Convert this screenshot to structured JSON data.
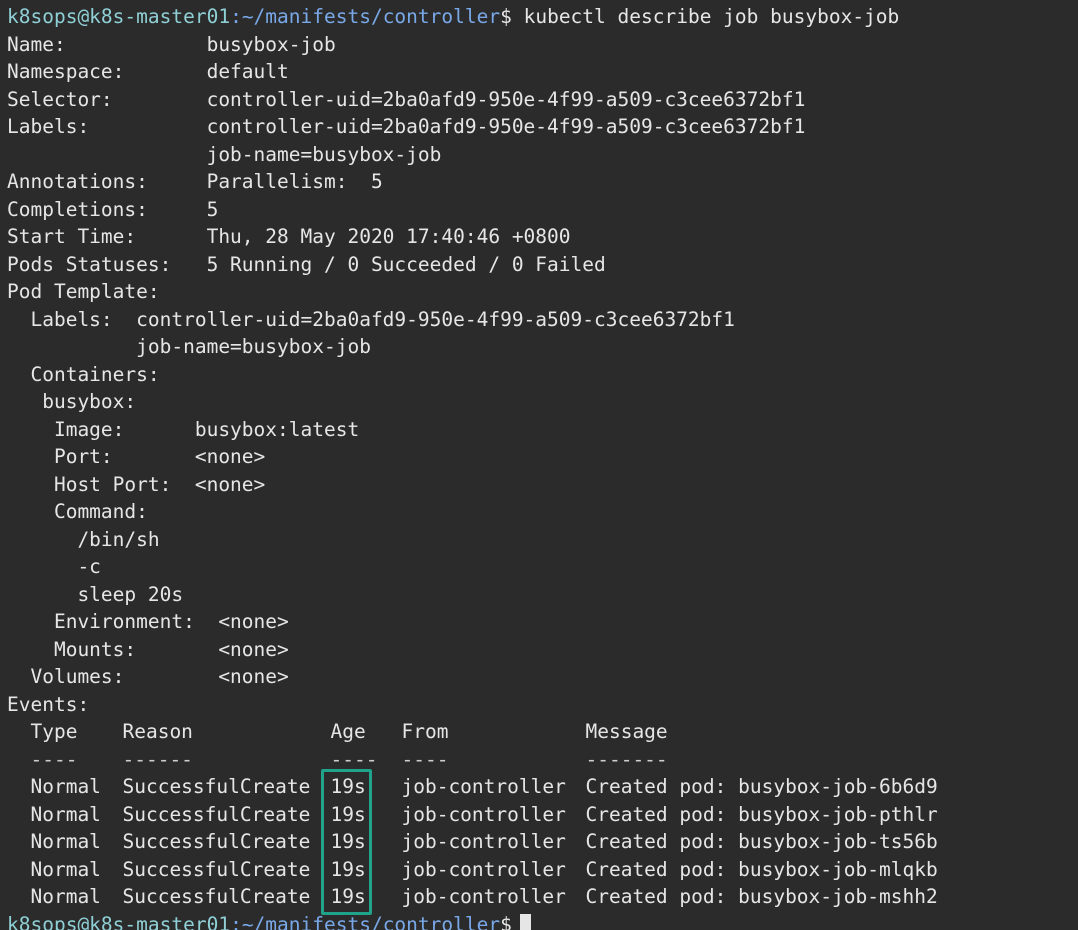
{
  "prompt": {
    "user_host": "k8sops@k8s-master01",
    "colon": ":",
    "path": "~/manifests/controller",
    "dollar": "$",
    "command": "kubectl describe job busybox-job"
  },
  "lines": [
    "Name:            busybox-job",
    "Namespace:       default",
    "Selector:        controller-uid=2ba0afd9-950e-4f99-a509-c3cee6372bf1",
    "Labels:          controller-uid=2ba0afd9-950e-4f99-a509-c3cee6372bf1",
    "                 job-name=busybox-job",
    "Annotations:     Parallelism:  5",
    "Completions:     5",
    "Start Time:      Thu, 28 May 2020 17:40:46 +0800",
    "Pods Statuses:   5 Running / 0 Succeeded / 0 Failed",
    "Pod Template:",
    "  Labels:  controller-uid=2ba0afd9-950e-4f99-a509-c3cee6372bf1",
    "           job-name=busybox-job",
    "  Containers:",
    "   busybox:",
    "    Image:      busybox:latest",
    "    Port:       <none>",
    "    Host Port:  <none>",
    "    Command:",
    "      /bin/sh",
    "      -c",
    "      sleep 20s",
    "    Environment:  <none>",
    "    Mounts:       <none>",
    "  Volumes:        <none>",
    "Events:"
  ],
  "events": {
    "headers": [
      "Type",
      "Reason",
      "Age",
      "From",
      "Message"
    ],
    "underlines": [
      "----",
      "------",
      "----",
      "----",
      "-------"
    ],
    "rows": [
      [
        "Normal",
        "SuccessfulCreate",
        "19s",
        "job-controller",
        "Created pod: busybox-job-6b6d9"
      ],
      [
        "Normal",
        "SuccessfulCreate",
        "19s",
        "job-controller",
        "Created pod: busybox-job-pthlr"
      ],
      [
        "Normal",
        "SuccessfulCreate",
        "19s",
        "job-controller",
        "Created pod: busybox-job-ts56b"
      ],
      [
        "Normal",
        "SuccessfulCreate",
        "19s",
        "job-controller",
        "Created pod: busybox-job-mlqkb"
      ],
      [
        "Normal",
        "SuccessfulCreate",
        "19s",
        "job-controller",
        "Created pod: busybox-job-mshh2"
      ]
    ]
  },
  "final_prompt": {
    "user_host": "k8sops@k8s-master01",
    "colon": ":",
    "path": "~/manifests/controller",
    "dollar": "$"
  },
  "colors": {
    "background": "#2b2b2b",
    "text": "#e6e6e6",
    "prompt_user": "#8fd0d6",
    "prompt_path": "#79a8e8",
    "highlight": "#1fa38a"
  }
}
